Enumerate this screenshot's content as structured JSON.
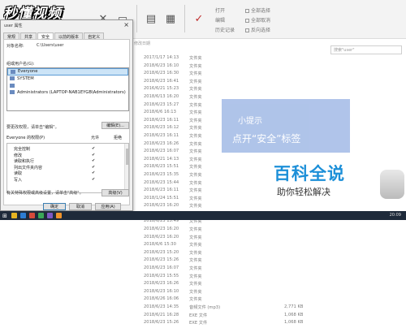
{
  "logo": {
    "text": "秒懂视频"
  },
  "ribbon": {
    "select_all": "全部选择",
    "select_none": "全部取消",
    "invert": "反向选择",
    "open": "打开",
    "edit": "编辑",
    "history": "历史记录"
  },
  "explorer": {
    "search_placeholder": "搜索\"user\"",
    "column_header": "修改日期",
    "rows": [
      {
        "date": "2017/1/17 14:13",
        "type": "文件夹"
      },
      {
        "date": "2018/6/23 16:10",
        "type": "文件夹"
      },
      {
        "date": "2018/6/23 16:30",
        "type": "文件夹"
      },
      {
        "date": "2018/6/23 16:41",
        "type": "文件夹"
      },
      {
        "date": "2016/6/21 15:23",
        "type": "文件夹"
      },
      {
        "date": "2018/6/13 16:20",
        "type": "文件夹"
      },
      {
        "date": "2018/6/23 15:27",
        "type": "文件夹"
      },
      {
        "date": "2018/6/6 16:13",
        "type": "文件夹"
      },
      {
        "date": "2018/6/23 16:11",
        "type": "文件夹"
      },
      {
        "date": "2018/6/23 16:12",
        "type": "文件夹"
      },
      {
        "date": "2018/6/23 16:11",
        "type": "文件夹"
      },
      {
        "date": "2018/6/23 16:26",
        "type": "文件夹"
      },
      {
        "date": "2018/6/23 16:07",
        "type": "文件夹"
      },
      {
        "date": "2018/6/21 14:13",
        "type": "文件夹"
      },
      {
        "date": "2018/6/23 15:51",
        "type": "文件夹"
      },
      {
        "date": "2018/6/23 15:35",
        "type": "文件夹"
      },
      {
        "date": "2018/6/23 15:44",
        "type": "文件夹"
      },
      {
        "date": "2018/6/23 16:11",
        "type": "文件夹"
      },
      {
        "date": "2018/1/24 15:51",
        "type": "文件夹"
      },
      {
        "date": "2018/6/23 16:20",
        "type": "文件夹"
      },
      {
        "date": "2018/6/23 10:01",
        "type": "文件夹"
      },
      {
        "date": "2018/6/23 15:49",
        "type": "文件夹"
      },
      {
        "date": "2018/6/23 16:20",
        "type": "文件夹"
      },
      {
        "date": "2018/6/23 16:20",
        "type": "文件夹"
      },
      {
        "date": "2018/6/6 15:30",
        "type": "文件夹"
      },
      {
        "date": "2018/6/23 15:20",
        "type": "文件夹"
      },
      {
        "date": "2018/6/23 15:26",
        "type": "文件夹"
      },
      {
        "date": "2018/6/23 16:07",
        "type": "文件夹"
      },
      {
        "date": "2018/6/23 15:55",
        "type": "文件夹"
      },
      {
        "date": "2018/6/23 16:26",
        "type": "文件夹"
      },
      {
        "date": "2018/6/23 16:10",
        "type": "文件夹"
      },
      {
        "date": "2018/6/26 16:06",
        "type": "文件夹"
      },
      {
        "date": "2018/6/23 14:35",
        "type": "音频文件 (mp3)",
        "size": "2,771 KB"
      },
      {
        "date": "2018/6/21 16:28",
        "type": "EXE 文件",
        "size": "1,068 KB"
      },
      {
        "date": "2018/6/23 15:26",
        "type": "EXE 文件",
        "size": "1,068 KB"
      }
    ]
  },
  "tip": {
    "title": "小提示",
    "text": "点开“安全”标签"
  },
  "brand": {
    "main": "百科全说",
    "sub": "助你轻松解决"
  },
  "dialog": {
    "title": "user 属性",
    "tabs": [
      "常规",
      "共享",
      "安全",
      "以前的版本",
      "自定义"
    ],
    "object_label": "对象名称:",
    "object_value": "C:\\Users\\user",
    "group_label": "组或用户名(G):",
    "users": [
      "Everyone",
      "SYSTEM",
      "",
      "Administrators (LAPTOP-NAB1EYGB\\Administrators)"
    ],
    "change_hint": "要更改权限，请单击\"编辑\"。",
    "edit_button": "编辑(E)...",
    "perm_for": "Everyone 的权限(P)",
    "allow": "允许",
    "deny": "拒绝",
    "perms": [
      {
        "name": "完全控制",
        "allow": "✔"
      },
      {
        "name": "修改",
        "allow": "✔"
      },
      {
        "name": "读取和执行",
        "allow": "✔"
      },
      {
        "name": "列出文件夹内容",
        "allow": "✔"
      },
      {
        "name": "读取",
        "allow": "✔"
      },
      {
        "name": "写入",
        "allow": "✔"
      }
    ],
    "advanced_hint": "有关特殊权限或高级设置，请单击\"高级\"。",
    "advanced_button": "高级(V)",
    "ok": "确定",
    "cancel": "取消",
    "apply": "应用(A)"
  },
  "taskbar": {
    "clock": "20:09"
  }
}
